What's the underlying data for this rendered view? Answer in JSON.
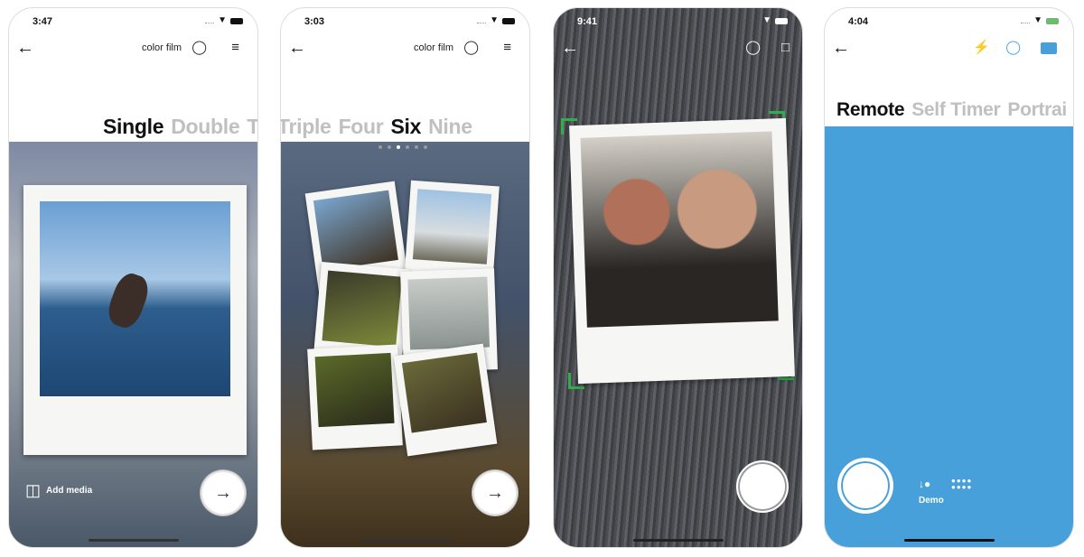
{
  "phones": [
    {
      "time": "3:47",
      "nav_label": "color film",
      "tabs": [
        "Single",
        "Double",
        "T"
      ],
      "active_tab": "Single",
      "add_media": "Add media",
      "icons": [
        "back-arrow-icon",
        "lightbulb-icon",
        "sliders-icon",
        "add-media-icon",
        "arrow-right-icon"
      ]
    },
    {
      "time": "3:03",
      "nav_label": "color film",
      "tabs": [
        "Triple",
        "Four",
        "Six",
        "Nine"
      ],
      "active_tab": "Six",
      "page_dots": 6,
      "active_dot": 3,
      "icons": [
        "back-arrow-icon",
        "lightbulb-icon",
        "sliders-icon",
        "arrow-right-icon"
      ]
    },
    {
      "time": "9:41",
      "icons": [
        "back-arrow-icon",
        "lightbulb-icon",
        "square-frame-icon",
        "shutter-button"
      ]
    },
    {
      "time": "4:04",
      "tabs": [
        "Remote",
        "Self Timer",
        "Portrai"
      ],
      "active_tab": "Remote",
      "demo_label": "Demo",
      "icons": [
        "back-arrow-icon",
        "flash-icon",
        "lightbulb-icon",
        "camera-icon",
        "demo-icon",
        "grid-dots-icon"
      ]
    }
  ],
  "colors": {
    "blue": "#47a0da",
    "green_corner": "#2fae4b",
    "inactive_tab": "#c0c0c0"
  }
}
